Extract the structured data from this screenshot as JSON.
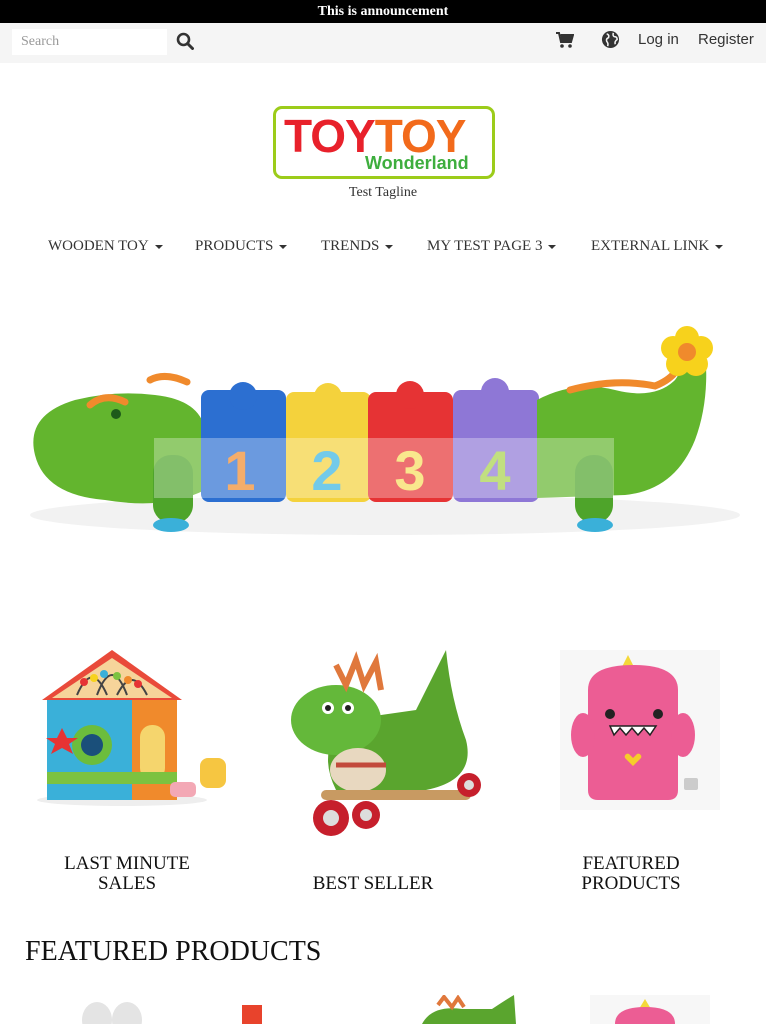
{
  "announcement": "This is announcement",
  "topbar": {
    "search_placeholder": "Search",
    "login_label": "Log in",
    "register_label": "Register",
    "icons": [
      "search-icon",
      "cart-icon",
      "globe-icon"
    ]
  },
  "brand": {
    "logo_part1": "TOY",
    "logo_part2": "TOY",
    "logo_sub": "Wonderland",
    "tagline": "Test Tagline",
    "colors": {
      "red": "#e8212b",
      "orange": "#f26a1b",
      "green": "#3eae3e",
      "border": "#9ccc1a"
    }
  },
  "nav": {
    "items": [
      {
        "label": "WOODEN TOY"
      },
      {
        "label": "PRODUCTS"
      },
      {
        "label": "TRENDS"
      },
      {
        "label": "MY TEST PAGE 3"
      },
      {
        "label": "EXTERNAL LINK"
      }
    ]
  },
  "hero": {
    "blocks": [
      "1",
      "2",
      "3",
      "4"
    ]
  },
  "categories": [
    {
      "line1": "LAST MINUTE",
      "line2": "SALES"
    },
    {
      "line1": "",
      "line2": "BEST SELLER"
    },
    {
      "line1": "FEATURED",
      "line2": "PRODUCTS"
    }
  ],
  "featured": {
    "heading": "FEATURED PRODUCTS"
  }
}
